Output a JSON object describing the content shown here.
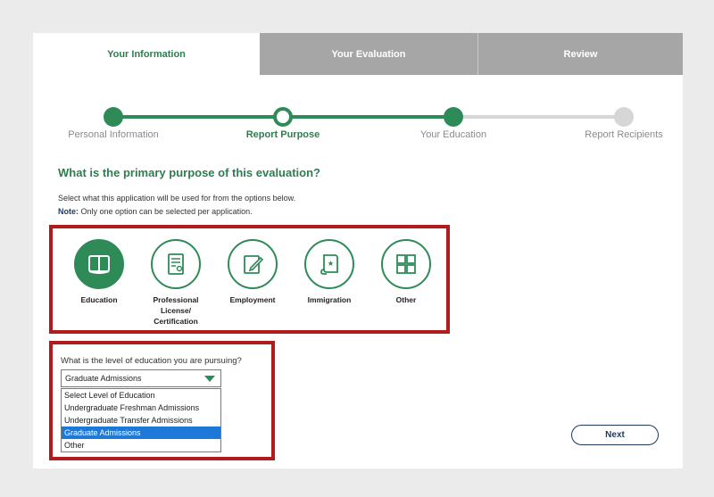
{
  "tabs": [
    {
      "label": "Your Information",
      "active": true
    },
    {
      "label": "Your Evaluation",
      "active": false
    },
    {
      "label": "Review",
      "active": false
    }
  ],
  "stepper": [
    {
      "label": "Personal Information",
      "state": "complete"
    },
    {
      "label": "Report Purpose",
      "state": "current"
    },
    {
      "label": "Your Education",
      "state": "complete"
    },
    {
      "label": "Report Recipients",
      "state": "pending"
    }
  ],
  "purpose": {
    "heading": "What is the primary purpose of this evaluation?",
    "instruction": "Select what this application will be used for from the options below.",
    "note_label": "Note:",
    "note_text": " Only one option can be selected per application.",
    "options": [
      {
        "label": "Education",
        "icon": "book-icon",
        "selected": true
      },
      {
        "label": "Professional License/ Certification",
        "icon": "certificate-icon",
        "selected": false
      },
      {
        "label": "Employment",
        "icon": "edit-document-icon",
        "selected": false
      },
      {
        "label": "Immigration",
        "icon": "scroll-icon",
        "selected": false
      },
      {
        "label": "Other",
        "icon": "grid-icon",
        "selected": false
      }
    ]
  },
  "education_level": {
    "question": "What is the level of education you are pursuing?",
    "selected_value": "Graduate Admissions",
    "options": [
      "Select Level of Education",
      "Undergraduate Freshman Admissions",
      "Undergraduate Transfer Admissions",
      "Graduate Admissions",
      "Other"
    ],
    "highlighted_index": 3
  },
  "next_label": "Next",
  "colors": {
    "accent": "#2e8b57",
    "highlight_border": "#b01c1c",
    "selection": "#1e78d7",
    "tab_inactive": "#a6a6a6"
  }
}
